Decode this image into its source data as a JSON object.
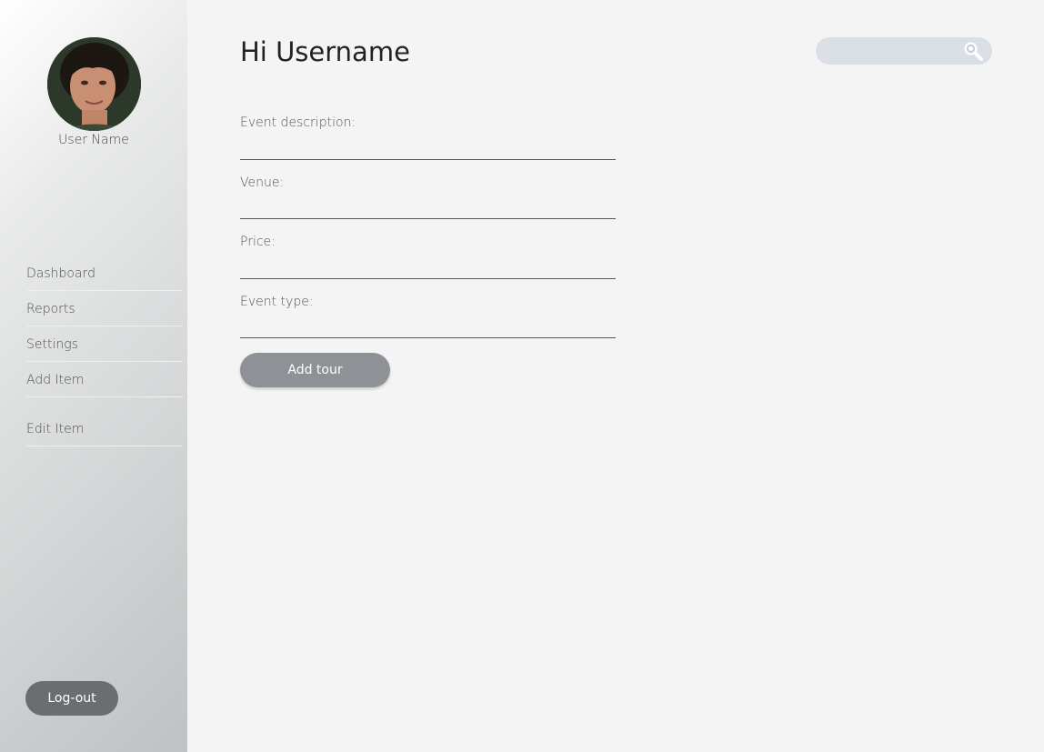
{
  "sidebar": {
    "user_name": "User Name",
    "items": [
      {
        "label": "Dashboard"
      },
      {
        "label": "Reports"
      },
      {
        "label": "Settings"
      },
      {
        "label": "Add Item"
      },
      {
        "label": "Edit Item"
      }
    ],
    "logout_label": "Log-out"
  },
  "header": {
    "title": "Hi Username",
    "search": {
      "placeholder": "",
      "icon": "search-icon"
    }
  },
  "form": {
    "fields": [
      {
        "label": "Event description:",
        "value": ""
      },
      {
        "label": "Venue:",
        "value": ""
      },
      {
        "label": "Price:",
        "value": ""
      },
      {
        "label": "Event type:",
        "value": ""
      }
    ],
    "submit_label": "Add tour"
  },
  "colors": {
    "search_bg": "#dadfe6",
    "add_button": "#8e9196",
    "logout_button": "#6a6e70"
  }
}
